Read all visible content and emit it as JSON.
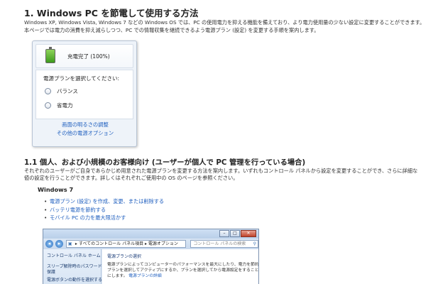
{
  "heading1": "1. Windows PC を節電して使用する方法",
  "intro": [
    "Windows XP, Windows Vista, Windows 7 などの Windows OS では、PC の使用電力を抑える機能を備えており、より電力使用量の少ない設定に変更することができます。また、スクリーン セーバーをブランクで使用するなども有効です。",
    "本ページでは電力の消費を抑え減らしつつ、PC での情報収集を継続できるよう電源プラン (設定) を変更する手順を案内します。"
  ],
  "battery_popup": {
    "status": "充電完了 (100%)",
    "plan_prompt": "電源プランを選択してください:",
    "options": [
      "バランス",
      "省電力"
    ],
    "links": [
      "画面の明るさの調整",
      "その他の電源オプション"
    ]
  },
  "heading2": "1.1 個人、および小規模のお客様向け (ユーザーが個人で PC 管理を行っている場合)",
  "intro2": [
    "それぞれのユーザーがご自身であらかじめ用意された電源プランを変更する方法を案内します。いずれもコントロール パネルから設定を変更することができ、さらに詳細な",
    "値の設定を行うことができます。詳しくはそれぞれご使用中の OS のページを参照ください。"
  ],
  "heading3": "Windows 7",
  "links": [
    "電源プラン (設定) を作成、変更、または削除する",
    "バッテリ電源を節約する",
    "モバイル PC の力を最大限活かす"
  ],
  "window": {
    "address": "▸ すべてのコントロール パネル項目 ▸ 電源オプション",
    "search_placeholder": "コントロール パネルの検索",
    "left_pane": [
      "コントロール パネル ホーム",
      "スリープ解除時のパスワード",
      "保護",
      "電源ボタンの動作を選択する"
    ],
    "main_title": "電源プランの選択",
    "main_text": [
      "電源プランによってコンピューターのパフォーマンスを最大にしたり、電力を節約したりできます。",
      "プランを選択してアクティブにするか、プランを選択してから電源設定をすることでカスタマイズ"
    ],
    "main_text3_prefix": "にします。",
    "main_link": "電源プランの詳細"
  }
}
